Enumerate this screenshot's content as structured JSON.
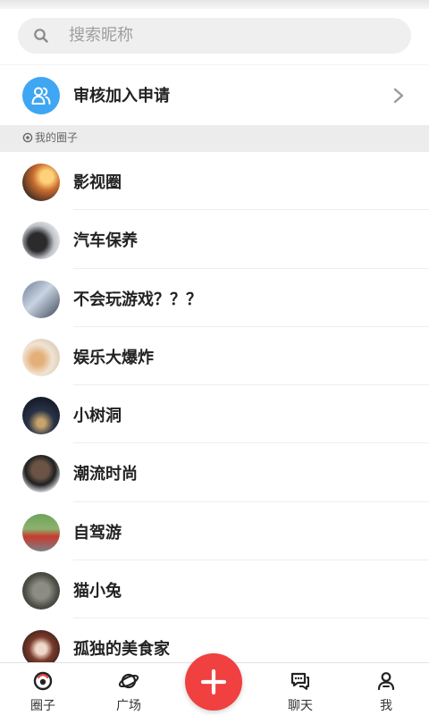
{
  "search": {
    "placeholder": "搜索昵称",
    "icon": "search-icon"
  },
  "review": {
    "label": "审核加入申请",
    "icon": "users-icon",
    "icon_color": "#3ea6f2"
  },
  "section": {
    "title": "我的圈子"
  },
  "circles": [
    {
      "name": "影视圈"
    },
    {
      "name": "汽车保养"
    },
    {
      "name": "不会玩游戏？？？"
    },
    {
      "name": "娱乐大爆炸"
    },
    {
      "name": "小树洞"
    },
    {
      "name": "潮流时尚"
    },
    {
      "name": "自驾游"
    },
    {
      "name": "猫小兔"
    },
    {
      "name": "孤独的美食家"
    }
  ],
  "tabbar": {
    "tabs": [
      {
        "label": "圈子",
        "icon": "circle-target-icon"
      },
      {
        "label": "广场",
        "icon": "planet-icon"
      },
      {
        "label": "聊天",
        "icon": "chat-bubbles-icon"
      },
      {
        "label": "我",
        "icon": "person-icon"
      }
    ],
    "fab_icon": "plus-icon",
    "fab_color": "#f04040"
  }
}
